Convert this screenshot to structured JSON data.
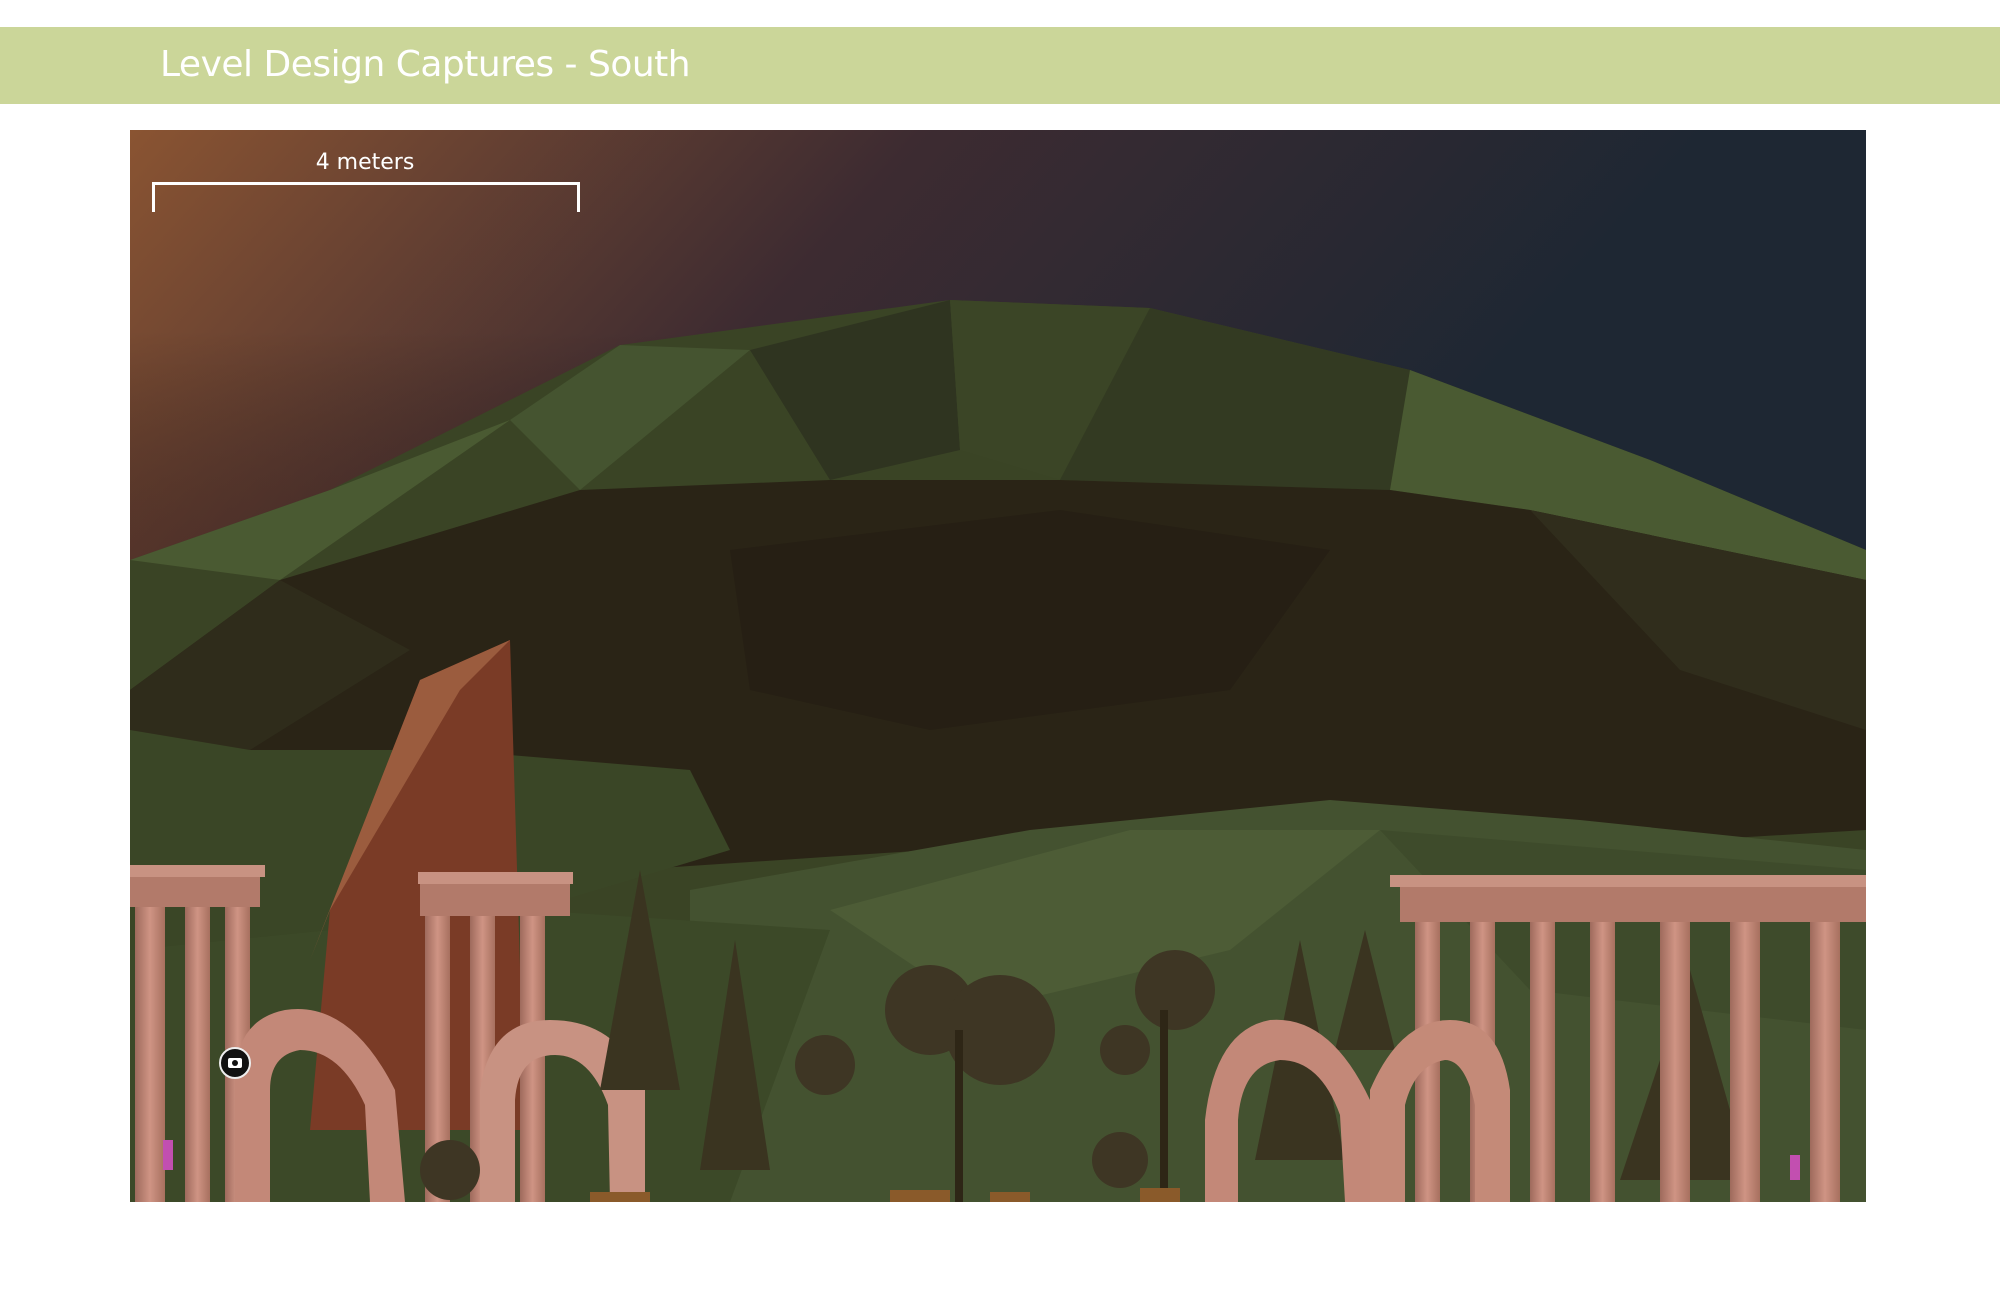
{
  "header": {
    "title": "Level Design Captures - South"
  },
  "capture": {
    "scale_label": "4 meters",
    "camera_marker": "camera-icon"
  },
  "colors": {
    "header_band": "#cbd699",
    "sky_top": "#1e2733",
    "sky_warm": "#8a5432",
    "hill_dark": "#2a2416",
    "hill_green": "#4a5a32",
    "ruins": "#c48a78"
  }
}
